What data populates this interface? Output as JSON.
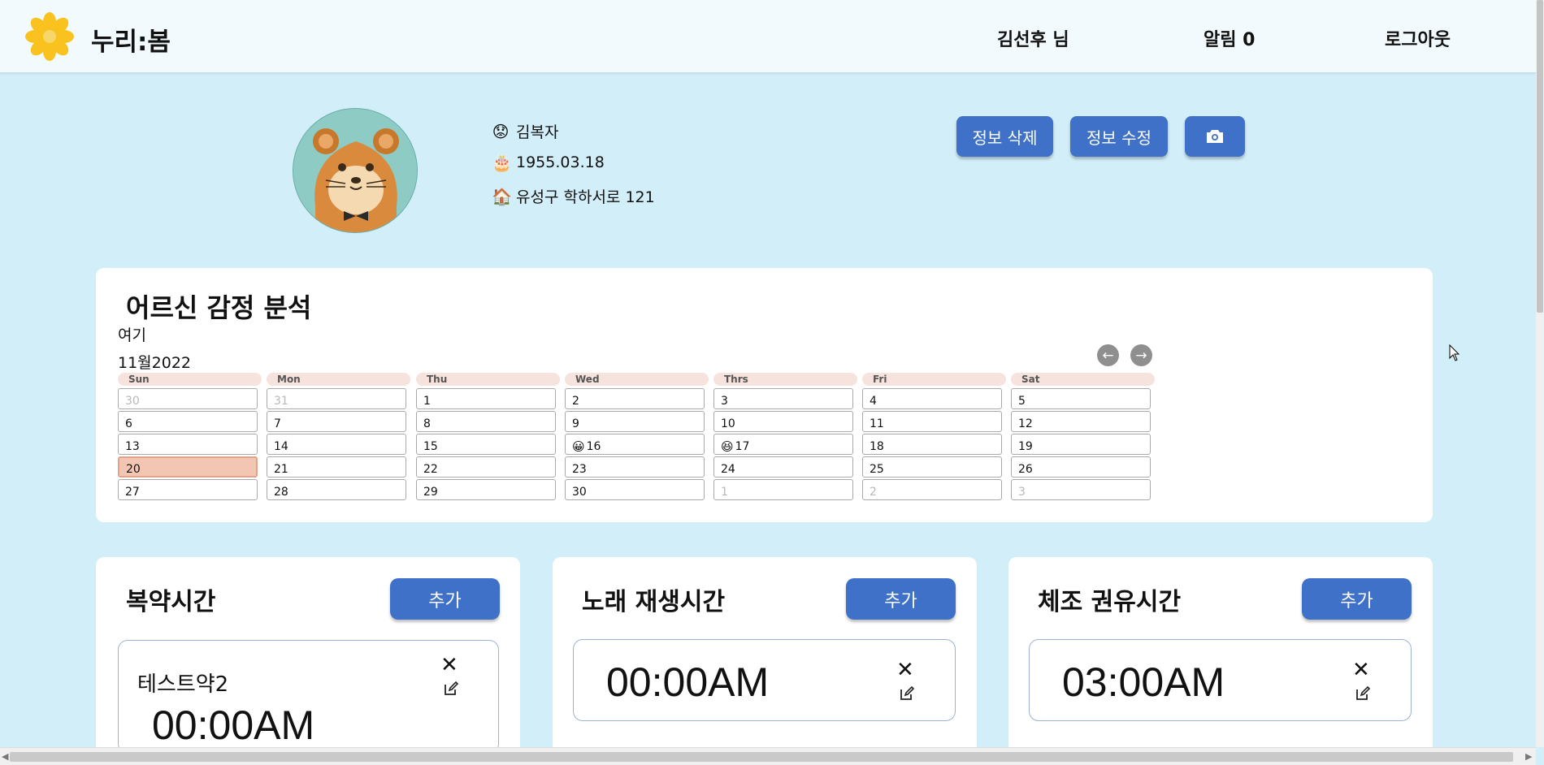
{
  "header": {
    "app_title": "누리:봄",
    "user": "김선후 님",
    "alarm_label": "알림",
    "alarm_count": "0",
    "logout": "로그아웃"
  },
  "profile": {
    "name": "김복자",
    "birth": "1955.03.18",
    "address": "유성구 학하서로 121",
    "delete_btn": "정보 삭제",
    "edit_btn": "정보 수정",
    "camera_icon": "camera-icon"
  },
  "emotion": {
    "title": "어르신 감정 분석",
    "location_note": "여기",
    "month_label": "11월2022",
    "days": [
      "Sun",
      "Mon",
      "Thu",
      "Wed",
      "Thrs",
      "Fri",
      "Sat"
    ],
    "weeks": [
      [
        {
          "d": "30",
          "dim": true
        },
        {
          "d": "31",
          "dim": true
        },
        {
          "d": "1"
        },
        {
          "d": "2"
        },
        {
          "d": "3"
        },
        {
          "d": "4"
        },
        {
          "d": "5"
        }
      ],
      [
        {
          "d": "6"
        },
        {
          "d": "7"
        },
        {
          "d": "8"
        },
        {
          "d": "9"
        },
        {
          "d": "10"
        },
        {
          "d": "11"
        },
        {
          "d": "12"
        }
      ],
      [
        {
          "d": "13"
        },
        {
          "d": "14"
        },
        {
          "d": "15"
        },
        {
          "d": "16",
          "emoji": "😀"
        },
        {
          "d": "17",
          "emoji": "😆"
        },
        {
          "d": "18"
        },
        {
          "d": "19"
        }
      ],
      [
        {
          "d": "20",
          "today": true
        },
        {
          "d": "21"
        },
        {
          "d": "22"
        },
        {
          "d": "23"
        },
        {
          "d": "24"
        },
        {
          "d": "25"
        },
        {
          "d": "26"
        }
      ],
      [
        {
          "d": "27"
        },
        {
          "d": "28"
        },
        {
          "d": "29"
        },
        {
          "d": "30"
        },
        {
          "d": "1",
          "dim": true
        },
        {
          "d": "2",
          "dim": true
        },
        {
          "d": "3",
          "dim": true
        }
      ]
    ]
  },
  "sections": {
    "medicine": {
      "title": "복약시간",
      "add": "추가",
      "item_name": "테스트약2",
      "time": "00:00AM"
    },
    "music": {
      "title": "노래 재생시간",
      "add": "추가",
      "time": "00:00AM"
    },
    "exercise": {
      "title": "체조 권유시간",
      "add": "추가",
      "time": "03:00AM"
    }
  },
  "colors": {
    "background": "#d2eef9",
    "primary_button": "#3f71c9",
    "today_cell": "#f2c6b3",
    "day_header": "#f7e3dd"
  }
}
